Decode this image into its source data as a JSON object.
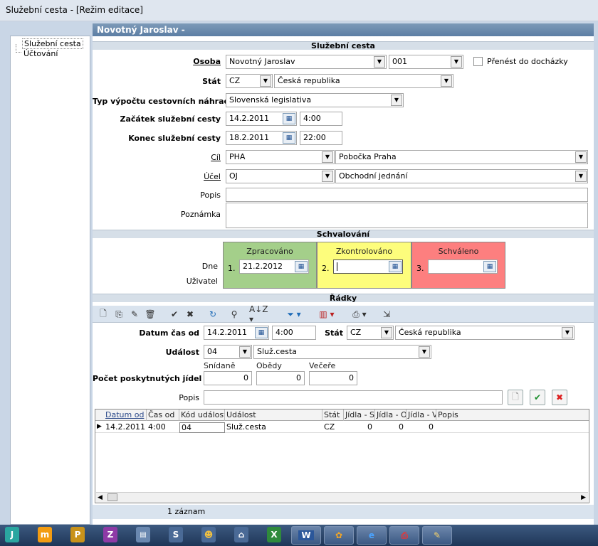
{
  "window": {
    "title": "Služební cesta - [Režim editace]"
  },
  "tree": {
    "items": [
      {
        "label": "Služební cesta"
      },
      {
        "label": "Účtování"
      }
    ]
  },
  "header": {
    "title": "Novotný Jaroslav  -"
  },
  "sections": {
    "trip": "Služební cesta",
    "approval": "Schvalování",
    "rows": "Řádky"
  },
  "form": {
    "osoba_label": "Osoba",
    "osoba_name": "Novotný Jaroslav",
    "osoba_code": "001",
    "prenest_label": "Přenést do docházky",
    "stat_label": "Stát",
    "stat_code": "CZ",
    "stat_name": "Česká republika",
    "typ_label": "Typ výpočtu cestovních náhrad",
    "typ_value": "Slovenská legislativa",
    "zacatek_label": "Začátek služební cesty",
    "zacatek_date": "14.2.2011",
    "zacatek_time": "4:00",
    "konec_label": "Konec služební cesty",
    "konec_date": "18.2.2011",
    "konec_time": "22:00",
    "cil_label": "Cíl",
    "cil_code": "PHA",
    "cil_name": "Pobočka Praha",
    "ucel_label": "Účel",
    "ucel_code": "OJ",
    "ucel_name": "Obchodní jednání",
    "popis_label": "Popis",
    "poznamka_label": "Poznámka"
  },
  "approval": {
    "dne_label": "Dne",
    "uzivatel_label": "Uživatel",
    "boxes": [
      {
        "title": "Zpracováno",
        "num": "1.",
        "date": "21.2.2012",
        "color": "#a4cf8a"
      },
      {
        "title": "Zkontrolováno",
        "num": "2.",
        "date": "",
        "color": "#fdfd7c"
      },
      {
        "title": "Schváleno",
        "num": "3.",
        "date": "",
        "color": "#fd7f7f"
      }
    ]
  },
  "rows_form": {
    "datum_label": "Datum čas od",
    "datum_date": "14.2.2011",
    "datum_time": "4:00",
    "stat_label": "Stát",
    "stat_code": "CZ",
    "stat_name": "Česká republika",
    "udalost_label": "Událost",
    "udalost_code": "04",
    "udalost_name": "Služ.cesta",
    "jidla_label": "Počet poskytnutých jídel",
    "snidane_label": "Snídaně",
    "snidane_value": "0",
    "obedy_label": "Obědy",
    "obedy_value": "0",
    "vecere_label": "Večeře",
    "vecere_value": "0",
    "popis_label": "Popis"
  },
  "grid": {
    "columns": [
      "Datum od",
      "Čas od",
      "Kód události",
      "Událost",
      "Stát",
      "Jídla - S",
      "Jídla - O",
      "Jídla - V",
      "Popis"
    ],
    "rows": [
      [
        "14.2.2011",
        "4:00",
        "04",
        "Služ.cesta",
        "CZ",
        "0",
        "0",
        "0",
        ""
      ]
    ]
  },
  "status": {
    "count": "1 záznam"
  },
  "taskbar": {
    "items": [
      "J",
      "m",
      "P",
      "Z",
      "W"
    ]
  }
}
